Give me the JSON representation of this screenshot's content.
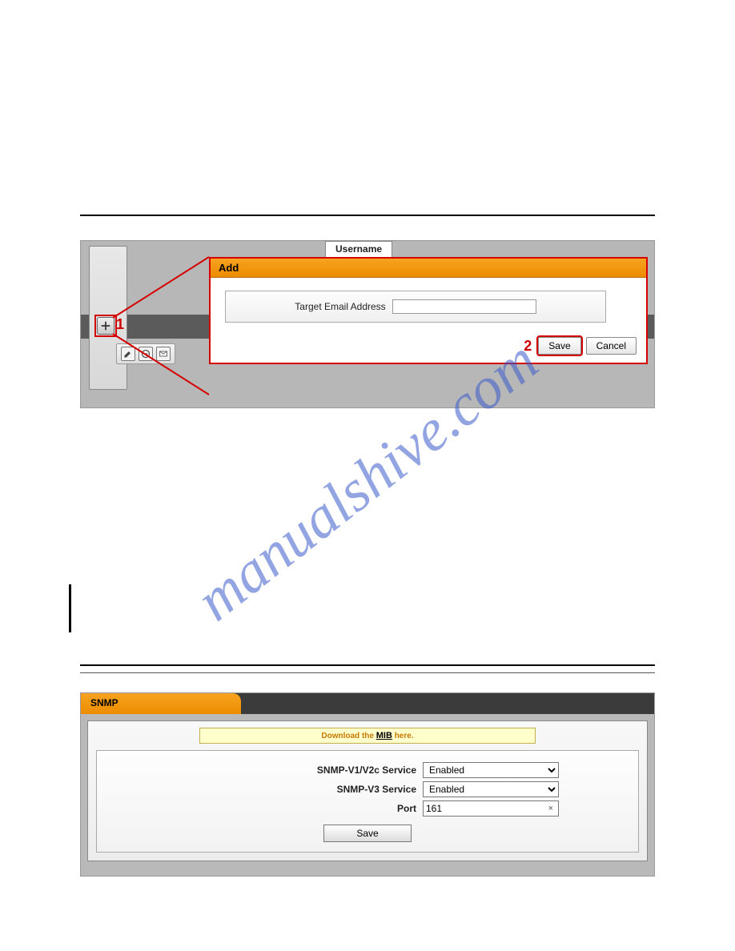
{
  "watermark": "manualshive.com",
  "shot1": {
    "username_header": "Username",
    "dialog_title": "Add",
    "field_label": "Target Email Address",
    "field_value": "",
    "marker1": "1",
    "marker2": "2",
    "save_label": "Save",
    "cancel_label": "Cancel"
  },
  "shot2": {
    "tab_label": "SNMP",
    "banner_download": "Download the",
    "banner_mib": "MIB",
    "banner_here": "here.",
    "fields": {
      "v1v2c_label": "SNMP-V1/V2c Service",
      "v1v2c_value": "Enabled",
      "v3_label": "SNMP-V3 Service",
      "v3_value": "Enabled",
      "port_label": "Port",
      "port_value": "161"
    },
    "save_label": "Save"
  }
}
